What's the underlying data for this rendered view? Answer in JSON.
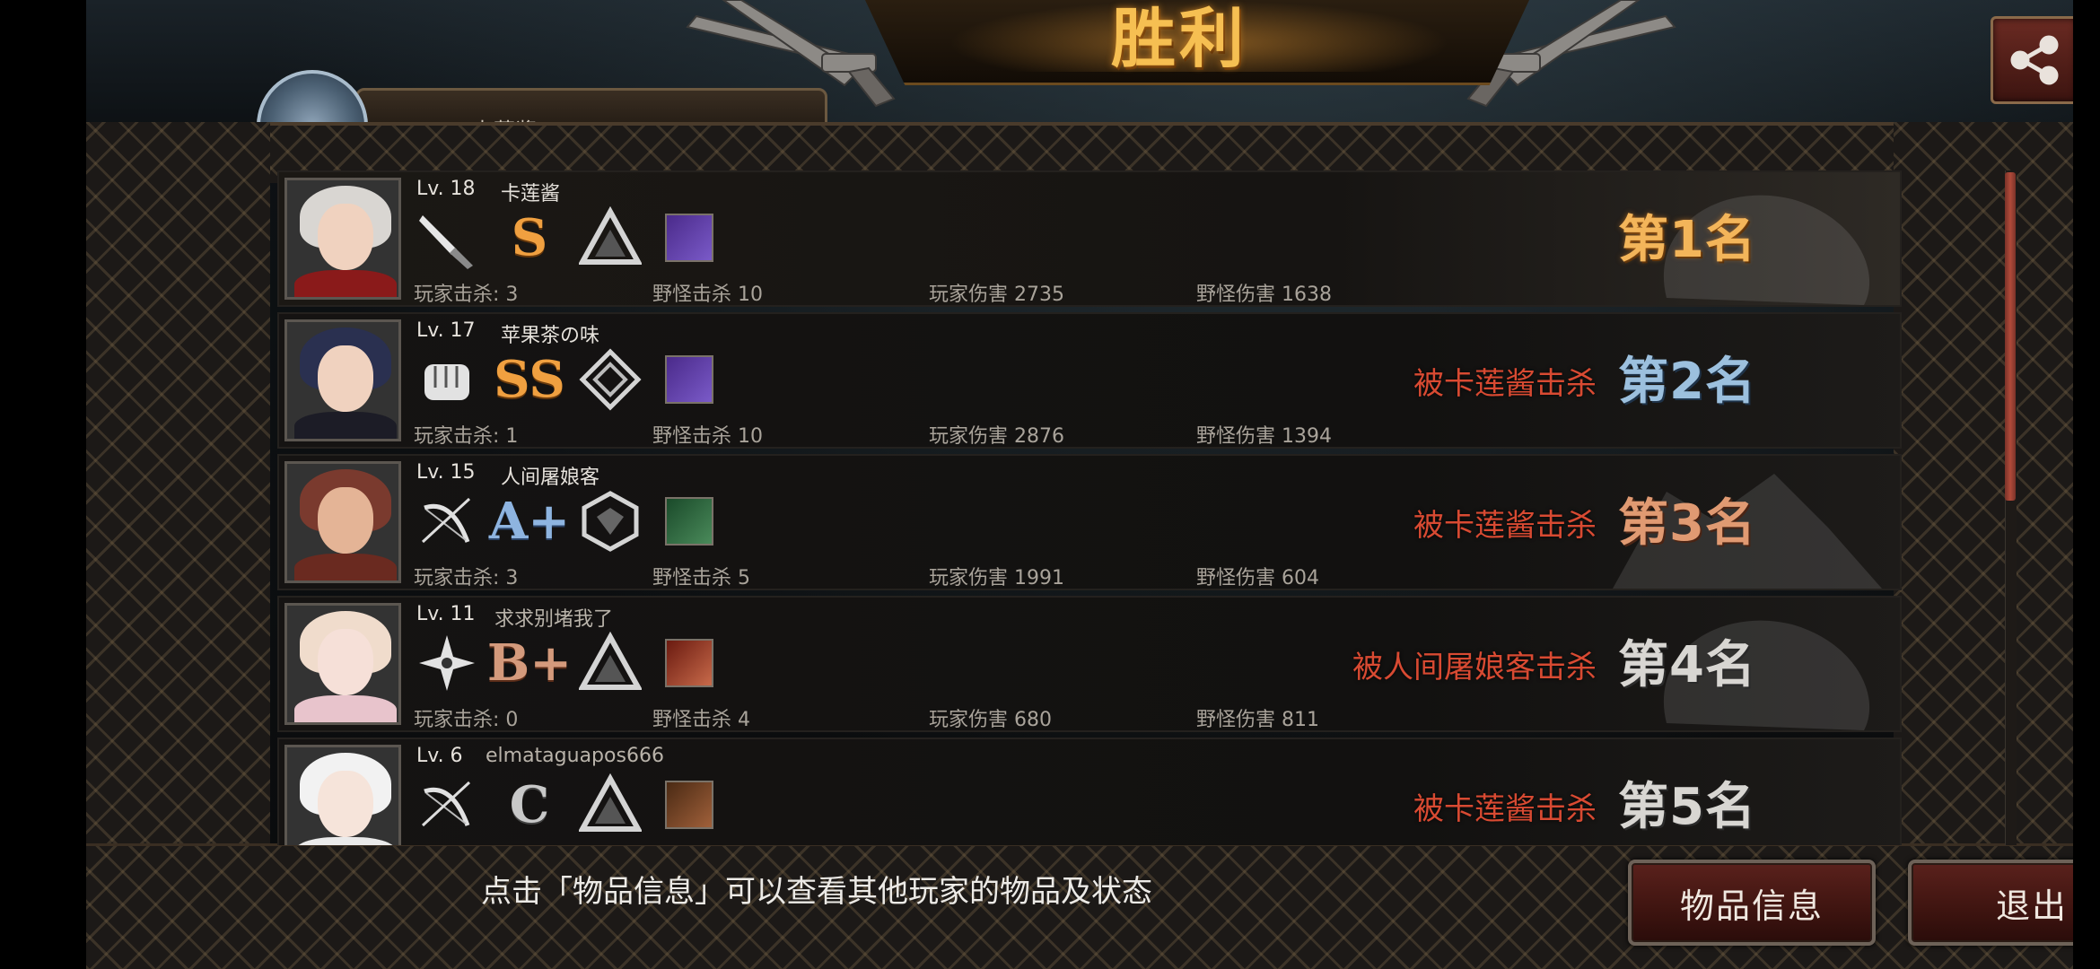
{
  "header": {
    "title": "胜利"
  },
  "self_panel": {
    "name": "卡莲酱"
  },
  "share": {
    "icon": "share-icon"
  },
  "players": [
    {
      "rank": "第1名",
      "rank_style": "gold",
      "level": "Lv. 18",
      "name": "卡莲酱",
      "weapon_icon": "knife-icon",
      "grade": "S",
      "grade_style": "gold",
      "kill_info": "",
      "stats": {
        "player_kills": "玩家击杀: 3",
        "monster_kills": "野怪击杀 10",
        "player_damage": "玩家伤害 2735",
        "monster_damage": "野怪伤害 1638"
      }
    },
    {
      "rank": "第2名",
      "rank_style": "silver",
      "level": "Lv. 17",
      "name": "苹果茶の味",
      "weapon_icon": "fist-icon",
      "grade": "SS",
      "grade_style": "gold",
      "kill_info": "被卡莲酱击杀",
      "stats": {
        "player_kills": "玩家击杀: 1",
        "monster_kills": "野怪击杀 10",
        "player_damage": "玩家伤害 2876",
        "monster_damage": "野怪伤害 1394"
      }
    },
    {
      "rank": "第3名",
      "rank_style": "bronze",
      "level": "Lv. 15",
      "name": "人间屠娘客",
      "weapon_icon": "bow-icon",
      "grade": "A+",
      "grade_style": "blue",
      "kill_info": "被卡莲酱击杀",
      "stats": {
        "player_kills": "玩家击杀: 3",
        "monster_kills": "野怪击杀 5",
        "player_damage": "玩家伤害 1991",
        "monster_damage": "野怪伤害 604"
      }
    },
    {
      "rank": "第4名",
      "rank_style": "plain",
      "level": "Lv. 11",
      "name": "求求别堵我了",
      "weapon_icon": "shuriken-icon",
      "grade": "B+",
      "grade_style": "copper",
      "kill_info": "被人间屠娘客击杀",
      "stats": {
        "player_kills": "玩家击杀: 0",
        "monster_kills": "野怪击杀 4",
        "player_damage": "玩家伤害 680",
        "monster_damage": "野怪伤害 811"
      }
    },
    {
      "rank": "第5名",
      "rank_style": "plain",
      "level": "Lv. 6",
      "name": "elmataguapos666",
      "weapon_icon": "bow-icon",
      "grade": "C",
      "grade_style": "grey",
      "kill_info": "被卡莲酱击杀",
      "stats": {
        "player_kills": "",
        "monster_kills": "",
        "player_damage": "",
        "monster_damage": ""
      }
    }
  ],
  "footer": {
    "hint": "点击「物品信息」可以查看其他玩家的物品及状态",
    "info_button": "物品信息",
    "exit_button": "退出"
  },
  "colors": {
    "accent": "#f6bf52",
    "kill_text": "#d84a32",
    "button": "#5a211c"
  }
}
